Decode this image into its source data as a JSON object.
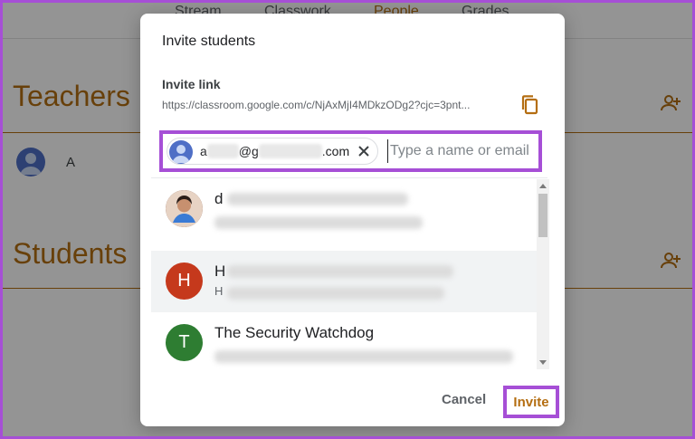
{
  "tabs": [
    {
      "label": "Stream"
    },
    {
      "label": "Classwork"
    },
    {
      "label": "People",
      "active": true
    },
    {
      "label": "Grades"
    }
  ],
  "sections": {
    "teachers": "Teachers",
    "students": "Students",
    "teacher_initial": "A"
  },
  "dialog": {
    "title": "Invite students",
    "invite_link_label": "Invite link",
    "invite_link_url": "https://classroom.google.com/c/NjAxMjI4MDkzODg2?cjc=3pnt...",
    "copy_icon": "copy-icon",
    "chip": {
      "email_prefix": "a",
      "email_mid": "@g",
      "email_suffix": ".com"
    },
    "input_placeholder": "Type a name or email",
    "suggestions": [
      {
        "name_visible": "d",
        "avatar": "photo",
        "sub_visible": ""
      },
      {
        "name_visible": "H",
        "avatar_letter": "H",
        "avatar_color": "#c5391c",
        "sub_visible": "H"
      },
      {
        "name_visible": "The Security Watchdog",
        "avatar_letter": "T",
        "avatar_color": "#2e7d32",
        "sub_visible": ""
      }
    ],
    "cancel_label": "Cancel",
    "invite_label": "Invite"
  },
  "colors": {
    "accent": "#b46e12",
    "highlight_frame": "#a64fd6",
    "scrim": "rgba(0,0,0,0.42)"
  }
}
